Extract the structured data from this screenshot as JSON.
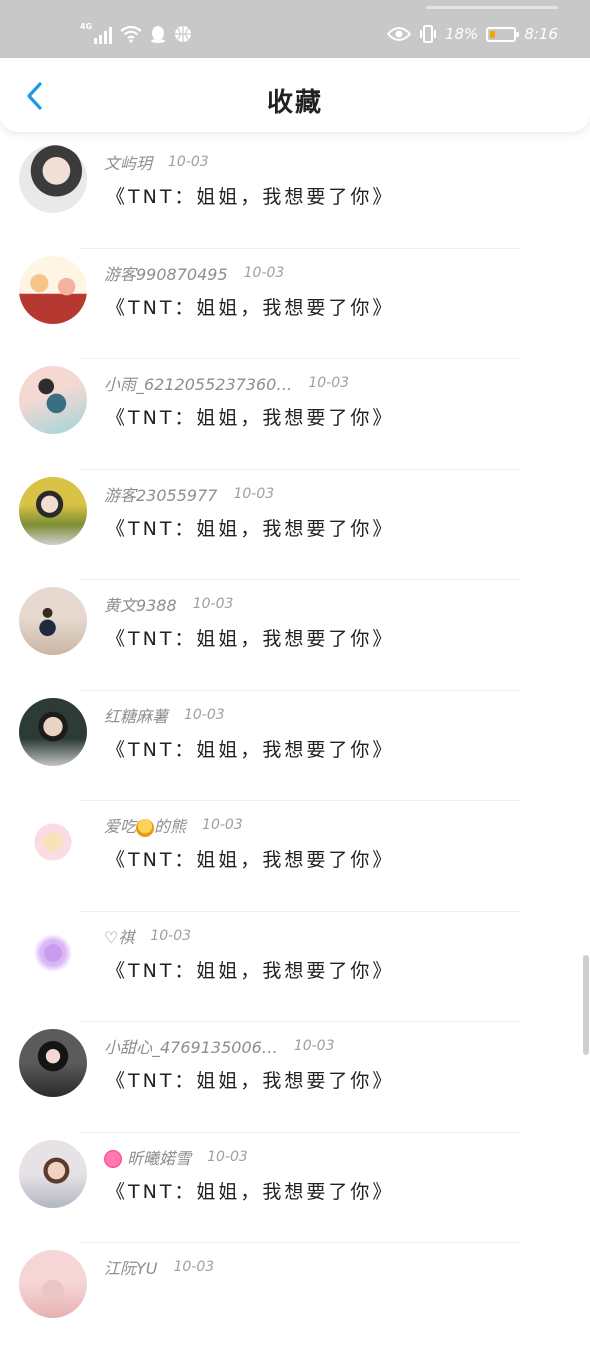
{
  "status_bar": {
    "network": "4G",
    "battery": "18%",
    "time": "8:16"
  },
  "header": {
    "back_icon": "chevron-left-icon",
    "title": "收藏"
  },
  "items": [
    {
      "name": "文屿玥",
      "date": "10-03",
      "content": "《TNT：姐姐，我想要了你》"
    },
    {
      "name": "游客990870495",
      "date": "10-03",
      "content": "《TNT：姐姐，我想要了你》"
    },
    {
      "name": "小雨_6212055237360…",
      "date": "10-03",
      "content": "《TNT：姐姐，我想要了你》"
    },
    {
      "name": "游客23055977",
      "date": "10-03",
      "content": "《TNT：姐姐，我想要了你》"
    },
    {
      "name": "黄文9388",
      "date": "10-03",
      "content": "《TNT：姐姐，我想要了你》"
    },
    {
      "name": "红糖麻薯",
      "date": "10-03",
      "content": "《TNT：姐姐，我想要了你》"
    },
    {
      "name_pre": "爱吃",
      "name_post": "的熊",
      "emoji": "honey-pot-icon",
      "date": "10-03",
      "content": "《TNT：姐姐，我想要了你》"
    },
    {
      "name": "♡祺",
      "date": "10-03",
      "content": "《TNT：姐姐，我想要了你》"
    },
    {
      "name": "小甜心_4769135006…",
      "date": "10-03",
      "content": "《TNT：姐姐，我想要了你》"
    },
    {
      "name": "昕曦婼雪",
      "emoji": "sparkling-heart-icon",
      "date": "10-03",
      "content": "《TNT：姐姐，我想要了你》"
    },
    {
      "name": "江阮YU",
      "date": "10-03",
      "content": ""
    }
  ]
}
